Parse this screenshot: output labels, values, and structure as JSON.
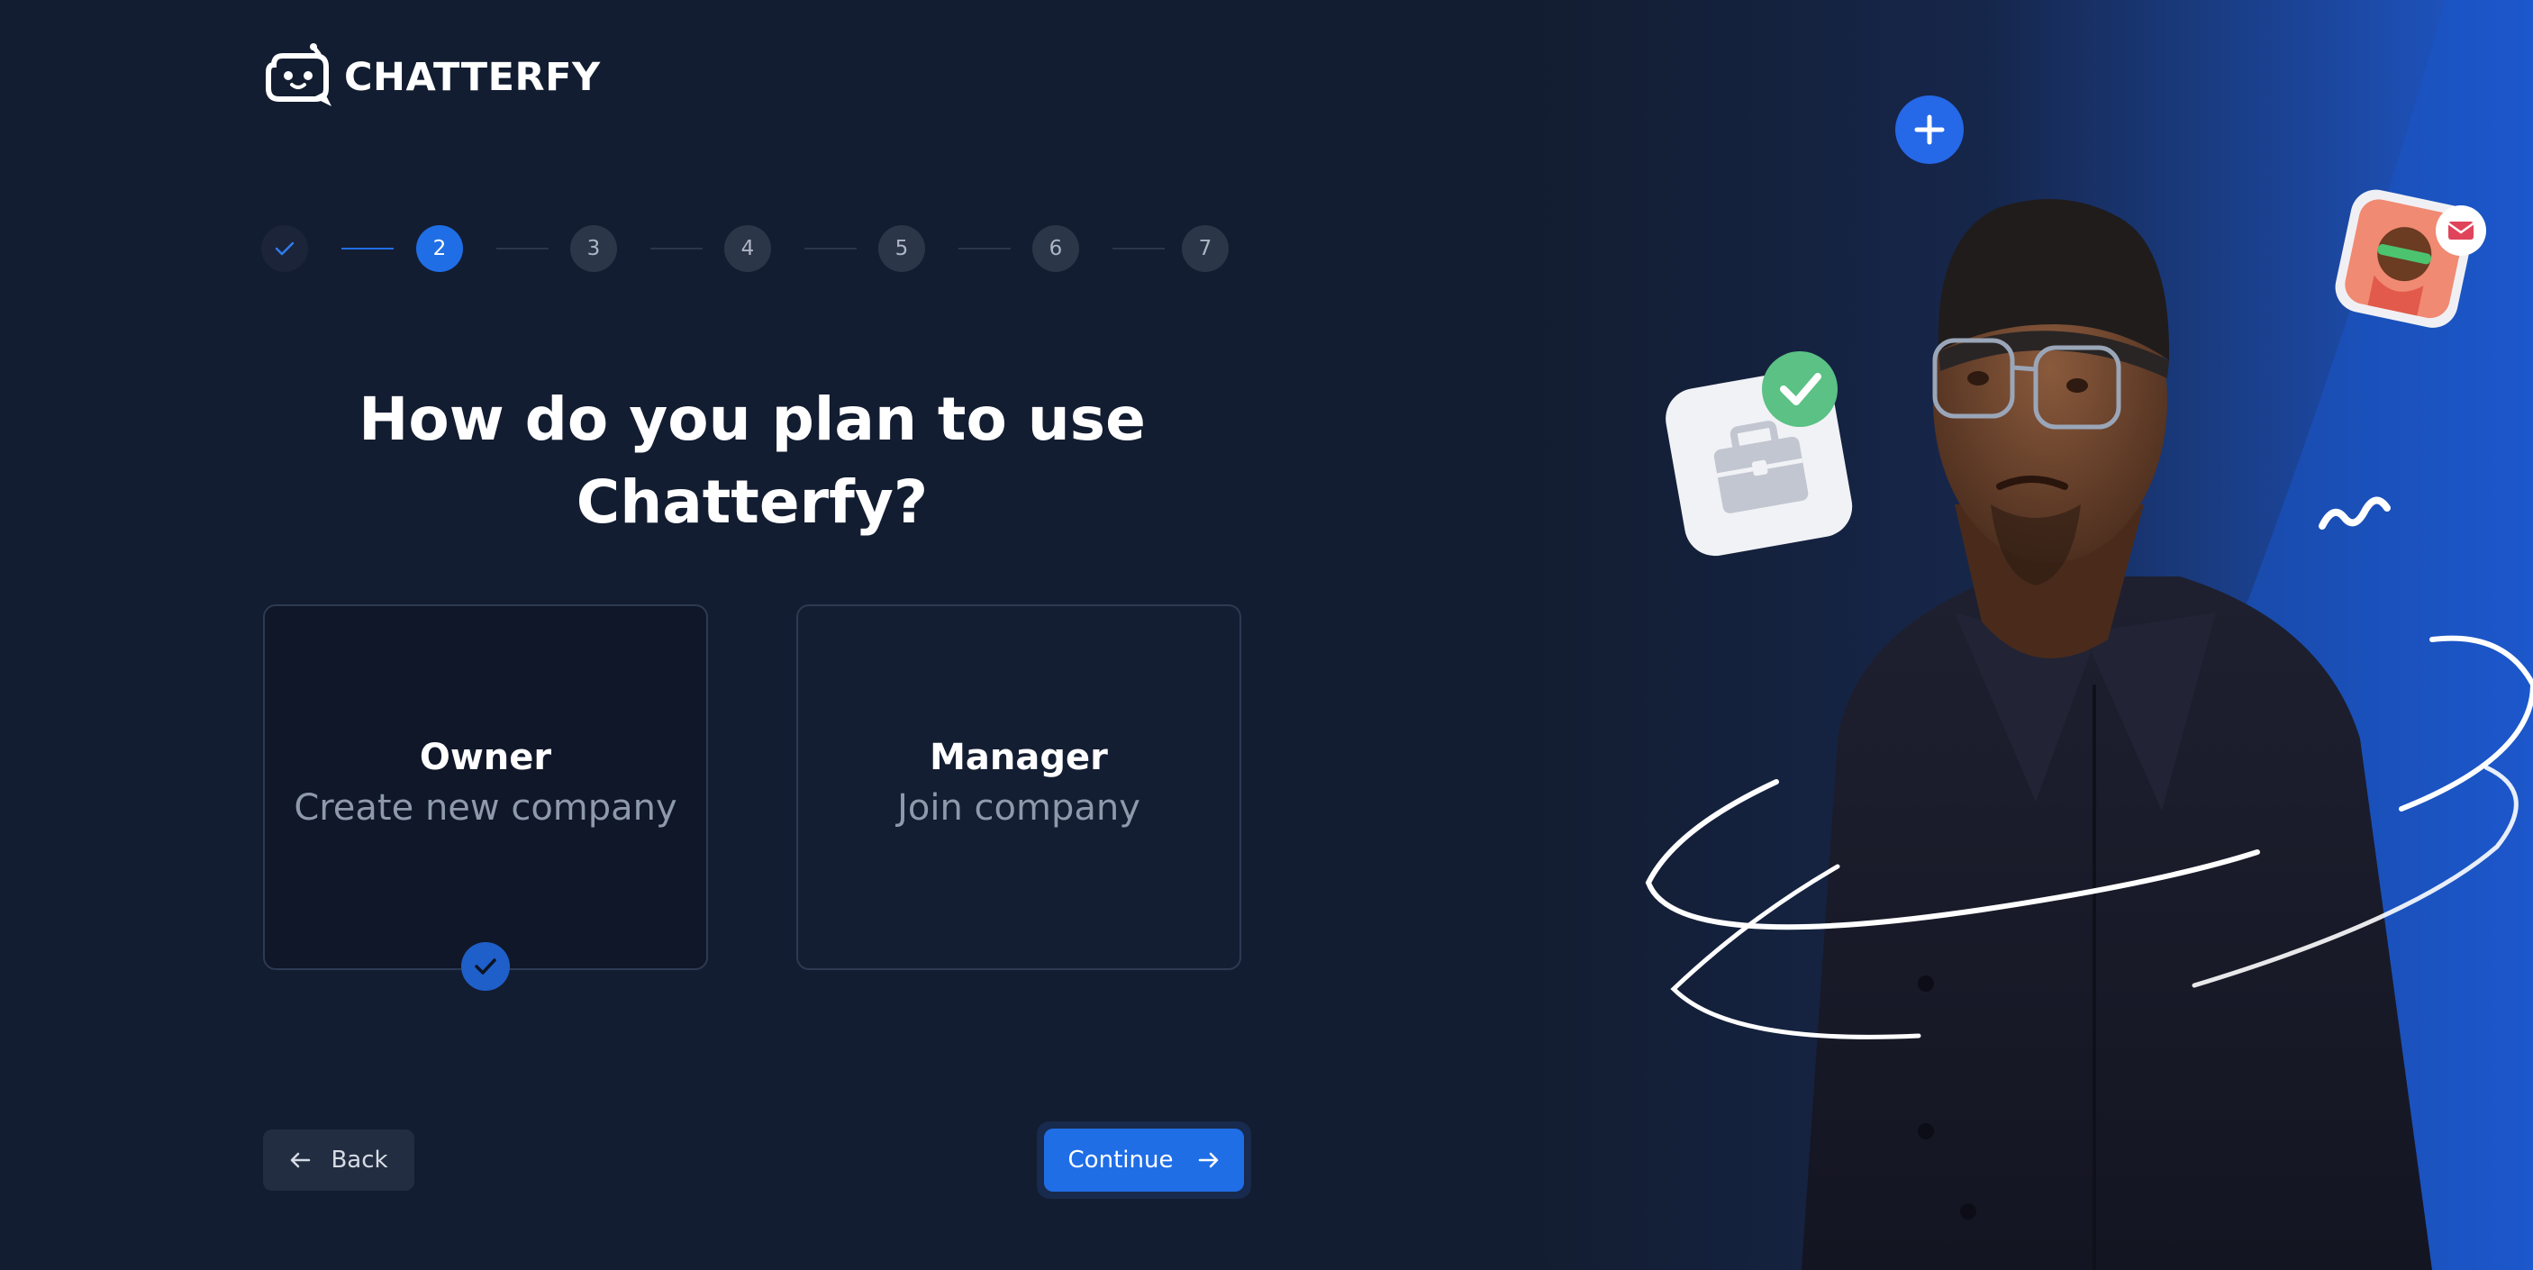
{
  "brand": {
    "name": "CHATTERFY"
  },
  "stepper": {
    "steps": [
      {
        "label": "",
        "state": "done"
      },
      {
        "label": "2",
        "state": "active"
      },
      {
        "label": "3",
        "state": "pending"
      },
      {
        "label": "4",
        "state": "pending"
      },
      {
        "label": "5",
        "state": "pending"
      },
      {
        "label": "6",
        "state": "pending"
      },
      {
        "label": "7",
        "state": "pending"
      }
    ]
  },
  "heading": {
    "line1": "How do you plan to use",
    "line2": "Chatterfy?"
  },
  "options": [
    {
      "title": "Owner",
      "subtitle": "Create new company",
      "selected": true
    },
    {
      "title": "Manager",
      "subtitle": "Join company",
      "selected": false
    }
  ],
  "buttons": {
    "back": "Back",
    "continue": "Continue"
  },
  "colors": {
    "background": "#131d31",
    "accent": "#1f6ee6",
    "card_border": "#2d3a52",
    "muted_text": "#8e99ab"
  }
}
